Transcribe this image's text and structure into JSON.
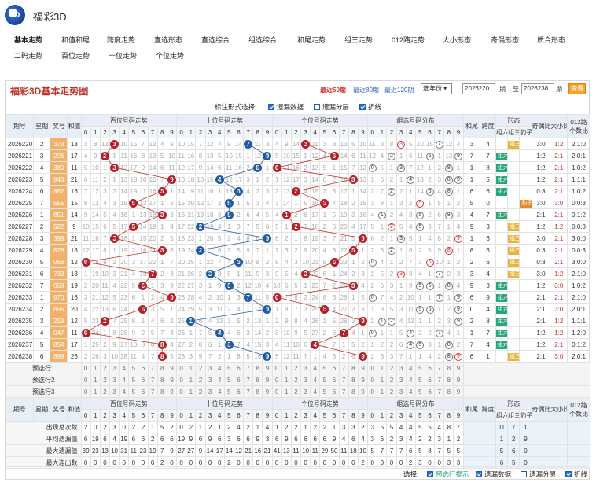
{
  "app": {
    "title": "福彩3D",
    "logo_text": "3D"
  },
  "nav": {
    "row1": [
      "基本走势",
      "和值和尾",
      "跨度走势",
      "直选形态",
      "直选综合",
      "组选综合",
      "和尾走势",
      "组三走势",
      "012路走势",
      "大小形态",
      "奇偶形态",
      "质合形态"
    ],
    "row2": [
      "二码走势",
      "百位走势",
      "十位走势",
      "个位走势"
    ],
    "active": "基本走势"
  },
  "panel": {
    "title": "福彩3D基本走势图",
    "recent": [
      "最近50期",
      "最近80期",
      "最近120期"
    ],
    "active_recent": "最近50期",
    "year_select": "选年份",
    "from_issue": "2026220",
    "from_label": "期",
    "to_label": "至",
    "to_issue": "2026238",
    "to_suffix": "期",
    "query": "查看"
  },
  "options": {
    "label": "标注形式选择:",
    "items": [
      {
        "label": "遗漏数据",
        "checked": true
      },
      {
        "label": "遗漏分层",
        "checked": false
      },
      {
        "label": "折线",
        "checked": true
      }
    ]
  },
  "headers": {
    "issue": "期号",
    "week": "星期",
    "prize": "奖号",
    "sum": "和值",
    "bai": "百位号码走势",
    "shi": "十位号码走势",
    "ge": "个位号码走势",
    "zuxuan": "组选号码分布",
    "hewei": "和尾",
    "kuadu": "跨度",
    "xingtai": "形态",
    "zu6": "组六",
    "zu3": "组三",
    "baozi": "豹子",
    "jiou": "奇偶比",
    "daxiao": "大小比",
    "lu012": "012路",
    "lu012b": "个数比",
    "digits": [
      "0",
      "1",
      "2",
      "3",
      "4",
      "5",
      "6",
      "7",
      "8",
      "9"
    ]
  },
  "rows": [
    {
      "issue": "2026220",
      "week": "2",
      "prize": "373",
      "sum": "13",
      "hw": "3",
      "kd": "4",
      "xt": "组三",
      "jo": "3:0",
      "dx": "1:2",
      "lu": "2:1:0"
    },
    {
      "issue": "2026221",
      "week": "3",
      "prize": "296",
      "sum": "17",
      "hw": "7",
      "kd": "7",
      "xt": "组六",
      "jo": "1:2",
      "dx": "2:1",
      "lu": "2:0:1"
    },
    {
      "issue": "2026222",
      "week": "4",
      "prize": "380",
      "sum": "11",
      "hw": "1",
      "kd": "8",
      "xt": "组六",
      "jo": "1:2",
      "dx": "2:1",
      "lu": "1:0:2"
    },
    {
      "issue": "2026223",
      "week": "5",
      "prize": "948",
      "sum": "21",
      "hw": "1",
      "kd": "5",
      "xt": "组六",
      "jo": "1:2",
      "dx": "2:1",
      "lu": "1:1:1"
    },
    {
      "issue": "2026224",
      "week": "6",
      "prize": "862",
      "sum": "16",
      "hw": "6",
      "kd": "6",
      "xt": "组六",
      "jo": "0:3",
      "dx": "2:1",
      "lu": "1:0:2"
    },
    {
      "issue": "2026225",
      "week": "7",
      "prize": "555",
      "sum": "15",
      "hw": "5",
      "kd": "0",
      "xt": "豹子",
      "jo": "3:0",
      "dx": "3:0",
      "lu": "0:0:3"
    },
    {
      "issue": "2026226",
      "week": "1",
      "prize": "851",
      "sum": "14",
      "hw": "4",
      "kd": "7",
      "xt": "组六",
      "jo": "2:1",
      "dx": "2:1",
      "lu": "0:1:2"
    },
    {
      "issue": "2026227",
      "week": "2",
      "prize": "522",
      "sum": "9",
      "hw": "9",
      "kd": "3",
      "xt": "组三",
      "jo": "1:2",
      "dx": "1:2",
      "lu": "0:0:3"
    },
    {
      "issue": "2026228",
      "week": "3",
      "prize": "399",
      "sum": "21",
      "hw": "1",
      "kd": "6",
      "xt": "组三",
      "jo": "3:0",
      "dx": "2:1",
      "lu": "3:0:0"
    },
    {
      "issue": "2026229",
      "week": "4",
      "prize": "828",
      "sum": "18",
      "hw": "8",
      "kd": "6",
      "xt": "组三",
      "jo": "0:3",
      "dx": "2:1",
      "lu": "0:0:3"
    },
    {
      "issue": "2026230",
      "week": "5",
      "prize": "066",
      "sum": "12",
      "hw": "2",
      "kd": "6",
      "xt": "组三",
      "jo": "0:3",
      "dx": "2:1",
      "lu": "3:0:0"
    },
    {
      "issue": "2026231",
      "week": "6",
      "prize": "733",
      "sum": "13",
      "hw": "3",
      "kd": "4",
      "xt": "组三",
      "jo": "3:0",
      "dx": "1:2",
      "lu": "2:1:0"
    },
    {
      "issue": "2026232",
      "week": "7",
      "prize": "658",
      "sum": "19",
      "hw": "9",
      "kd": "3",
      "xt": "组六",
      "jo": "1:2",
      "dx": "3:0",
      "lu": "1:0:2"
    },
    {
      "issue": "2026233",
      "week": "1",
      "prize": "970",
      "sum": "16",
      "hw": "6",
      "kd": "9",
      "xt": "组六",
      "jo": "2:1",
      "dx": "2:1",
      "lu": "2:1:0"
    },
    {
      "issue": "2026234",
      "week": "2",
      "prize": "695",
      "sum": "20",
      "hw": "0",
      "kd": "4",
      "xt": "组六",
      "jo": "2:1",
      "dx": "3:0",
      "lu": "2:0:1"
    },
    {
      "issue": "2026235",
      "week": "3",
      "prize": "219",
      "sum": "12",
      "hw": "2",
      "kd": "8",
      "xt": "组六",
      "jo": "2:1",
      "dx": "1:2",
      "lu": "1:1:1"
    },
    {
      "issue": "2026236",
      "week": "4",
      "prize": "047",
      "sum": "11",
      "hw": "1",
      "kd": "7",
      "xt": "组六",
      "jo": "1:2",
      "dx": "1:2",
      "lu": "1:2:0"
    },
    {
      "issue": "2026237",
      "week": "5",
      "prize": "854",
      "sum": "17",
      "hw": "7",
      "kd": "4",
      "xt": "组六",
      "jo": "1:2",
      "dx": "2:1",
      "lu": "0:1:2"
    },
    {
      "issue": "2026238",
      "week": "6",
      "prize": "899",
      "sum": "26",
      "hw": "6",
      "kd": "1",
      "xt": "组三",
      "jo": "2:1",
      "dx": "3:0",
      "lu": "2:0:1"
    }
  ],
  "preselect": [
    "预选行1",
    "预选行2",
    "预选行3"
  ],
  "stats": {
    "labels": [
      "出现总次数",
      "平均遗漏值",
      "最大遗漏值",
      "最大连出数"
    ],
    "bai": [
      [
        "2",
        "0",
        "2",
        "3",
        "0",
        "2",
        "2",
        "1",
        "5",
        "2"
      ],
      [
        "6",
        "19",
        "6",
        "4",
        "19",
        "6",
        "6",
        "2",
        "6",
        "6"
      ],
      [
        "39",
        "23",
        "13",
        "10",
        "31",
        "11",
        "23",
        "19",
        "7",
        "9"
      ],
      [
        "0",
        "0",
        "0",
        "0",
        "0",
        "0",
        "0",
        "0",
        "2",
        "0"
      ]
    ],
    "shi": [
      [
        "0",
        "2",
        "1",
        "2",
        "1",
        "2",
        "4",
        "2",
        "1",
        "4"
      ],
      [
        "19",
        "9",
        "6",
        "9",
        "6",
        "3",
        "6",
        "6",
        "9",
        "3"
      ],
      [
        "27",
        "27",
        "9",
        "14",
        "17",
        "14",
        "12",
        "21",
        "16",
        "21"
      ],
      [
        "0",
        "0",
        "0",
        "0",
        "0",
        "2",
        "0",
        "0",
        "0",
        "0"
      ]
    ],
    "ge": [
      [
        "1",
        "2",
        "2",
        "1",
        "2",
        "2",
        "1",
        "3",
        "3",
        "2"
      ],
      [
        "6",
        "9",
        "6",
        "6",
        "6",
        "6",
        "9",
        "4",
        "6",
        "4"
      ],
      [
        "41",
        "13",
        "11",
        "10",
        "11",
        "29",
        "50",
        "11",
        "18",
        "10"
      ],
      [
        "0",
        "0",
        "0",
        "0",
        "0",
        "0",
        "0",
        "0",
        "0",
        "2"
      ]
    ],
    "zu": [
      [
        "3",
        "5",
        "5",
        "4",
        "4",
        "5",
        "5",
        "4",
        "8",
        "7"
      ],
      [
        "3",
        "6",
        "2",
        "3",
        "4",
        "2",
        "2",
        "3",
        "1",
        "2"
      ],
      [
        "5",
        "7",
        "7",
        "7",
        "6",
        "5",
        "8",
        "7",
        "5",
        "5"
      ],
      [
        "0",
        "0",
        "0",
        "0",
        "2",
        "3",
        "0",
        "0",
        "3",
        "3"
      ]
    ],
    "xt": [
      [
        "11",
        "7",
        "1"
      ],
      [
        "1",
        "2",
        "9"
      ],
      [
        "5",
        "6",
        "0"
      ],
      [
        "6",
        "5",
        "0"
      ]
    ]
  },
  "footer": {
    "label": "选择:",
    "items": [
      {
        "label": "预选行提示",
        "checked": true,
        "accent": true
      },
      {
        "label": "遗漏数据",
        "checked": true
      },
      {
        "label": "遗漏分层",
        "checked": false
      },
      {
        "label": "折线",
        "checked": true
      }
    ]
  }
}
